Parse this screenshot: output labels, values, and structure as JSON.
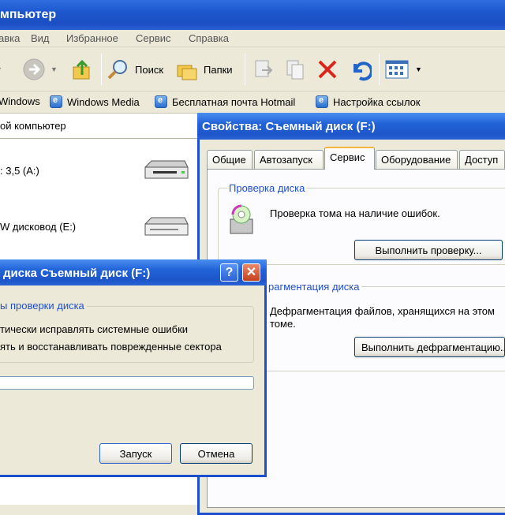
{
  "explorer": {
    "title": "мпьютер",
    "menu": [
      "авка",
      "Вид",
      "Избранное",
      "Сервис",
      "Справка"
    ],
    "toolbar": {
      "search_label": "Поиск",
      "folders_label": "Папки"
    },
    "links": [
      "Windows",
      "Windows Media",
      "Бесплатная почта Hotmail",
      "Настройка ссылок"
    ],
    "address": "ой компьютер",
    "drives": [
      {
        "label": ": 3,5 (A:)"
      },
      {
        "label": "W дисковод (E:)"
      }
    ]
  },
  "properties": {
    "title": "Свойства: Съемный диск (F:)",
    "tabs": [
      "Общие",
      "Автозапуск",
      "Сервис",
      "Оборудование",
      "Доступ"
    ],
    "active_tab": "Сервис",
    "check_group_title": "Проверка диска",
    "check_text": "Проверка тома на наличие ошибок.",
    "check_button": "Выполнить проверку...",
    "defrag_group_title": "рагментация диска",
    "defrag_text_line1": "Дефрагментация файлов, хранящихся на этом",
    "defrag_text_line2": "томе.",
    "defrag_button": "Выполнить дефрагментацию..."
  },
  "check_dialog": {
    "title": "диска Съемный диск (F:)",
    "help_glyph": "?",
    "close_glyph": "✕",
    "options_title": "ы проверки диска",
    "option1": "тически исправлять системные ошибки",
    "option2": "ять и восстанавливать поврежденные сектора",
    "start_button": "Запуск",
    "cancel_button": "Отмена"
  },
  "colors": {
    "title_blue": "#1d55c9",
    "group_title": "#1f4fc9",
    "window_bg": "#ece9d8"
  }
}
